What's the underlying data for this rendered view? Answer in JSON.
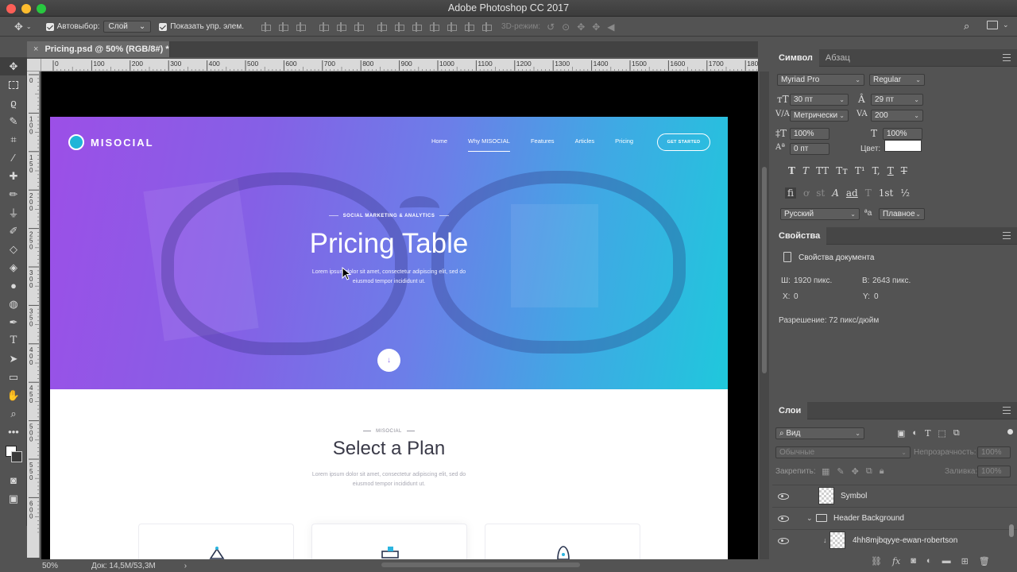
{
  "window": {
    "title": "Adobe Photoshop CC 2017"
  },
  "options_bar": {
    "autoselect_label": "Автовыбор:",
    "autoselect_value": "Слой",
    "show_controls_label": "Показать упр. элем.",
    "mode3d_label": "3D-режим:"
  },
  "document": {
    "tab_title": "Pricing.psd @ 50% (RGB/8#) *",
    "close_glyph": "×",
    "zoom": "50%",
    "doc_size": "Док: 14,5M/53,3M"
  },
  "ruler": {
    "h_ticks": [
      "0",
      "100",
      "200",
      "300",
      "400",
      "500",
      "600",
      "700",
      "800",
      "900",
      "1000",
      "1100",
      "1200",
      "1300",
      "1400",
      "1500",
      "1600",
      "1700",
      "1800"
    ],
    "v_ticks": [
      "0",
      "1 0 0",
      "1 5 0",
      "2 0 0",
      "2 5 0",
      "3 0 0",
      "3 5 0",
      "4 0 0",
      "4 5 0",
      "5 0 0",
      "5 5 0",
      "6 0 0"
    ]
  },
  "webpage": {
    "brand": "MISOCIAL",
    "nav": [
      "Home",
      "Why MISOCIAL",
      "Features",
      "Articles",
      "Pricing"
    ],
    "cta": "GET STARTED",
    "hero_kicker": "SOCIAL MARKETING & ANALYTICS",
    "hero_title": "Pricing Table",
    "hero_sub": "Lorem ipsum dolor sit amet, consectetur adipiscing elit, sed do eiusmod tempor incididunt ut.",
    "down_arrow": "↓",
    "plan_kicker": "MISOCIAL",
    "plan_title": "Select a Plan",
    "plan_sub": "Lorem ipsum dolor sit amet, consectetur adipiscing elit, sed do eiusmod tempor incididunt ut."
  },
  "character_panel": {
    "tab_active": "Символ",
    "tab_other": "Абзац",
    "font_family": "Myriad Pro",
    "font_style": "Regular",
    "font_size": "30 пт",
    "leading": "29 пт",
    "kerning": "Метрически",
    "tracking": "200",
    "vscale": "100%",
    "hscale": "100%",
    "baseline": "0 пт",
    "color_label": "Цвет:",
    "language": "Русский",
    "aa_label": "ªa",
    "antialias": "Плавное",
    "style_glyphs": [
      "T",
      "T",
      "TT",
      "Tт",
      "T¹",
      "T,",
      "T",
      "T"
    ],
    "ot_glyphs": [
      "fi",
      "ơ",
      "st",
      "A",
      "ad",
      "T",
      "1st",
      "½"
    ]
  },
  "properties_panel": {
    "title": "Свойства",
    "doc_props": "Свойства документа",
    "width_label": "Ш:",
    "width": "1920 пикс.",
    "height_label": "В:",
    "height": "2643 пикс.",
    "x_label": "X:",
    "x": "0",
    "y_label": "Y:",
    "y": "0",
    "resolution": "Разрешение: 72 пикс/дюйм"
  },
  "layers_panel": {
    "title": "Слои",
    "filter": "Вид",
    "blend": "Обычные",
    "opacity_label": "Непрозрачность:",
    "opacity": "100%",
    "lock_label": "Закрепить:",
    "fill_label": "Заливка:",
    "fill": "100%",
    "layers": [
      {
        "name": "Symbol",
        "kind": "layer"
      },
      {
        "name": "Header Background",
        "kind": "group"
      },
      {
        "name": "4hh8mjbqyye-ewan-robertson",
        "kind": "layer"
      }
    ]
  },
  "colors": {
    "hero_start": "#9c4fe7",
    "hero_end": "#1fc8dc",
    "panel_bg": "#535353"
  }
}
